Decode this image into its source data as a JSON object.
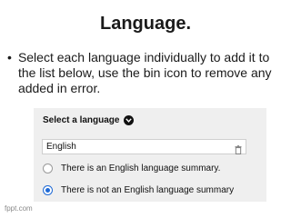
{
  "slide": {
    "title": "Language.",
    "bullet": "Select each language individually to add it to the list below, use the bin icon  to remove any added in error."
  },
  "panel": {
    "header_label": "Select a language",
    "header_icon": "chevron-down-icon",
    "select": {
      "value": "English",
      "icon": "trash-icon"
    },
    "radios": [
      {
        "label": "There is an English language summary.",
        "checked": false
      },
      {
        "label": "There is not an English language summary",
        "checked": true
      }
    ],
    "accent_color": "#1f6ad6"
  },
  "footer": {
    "text": "fppt.com"
  }
}
